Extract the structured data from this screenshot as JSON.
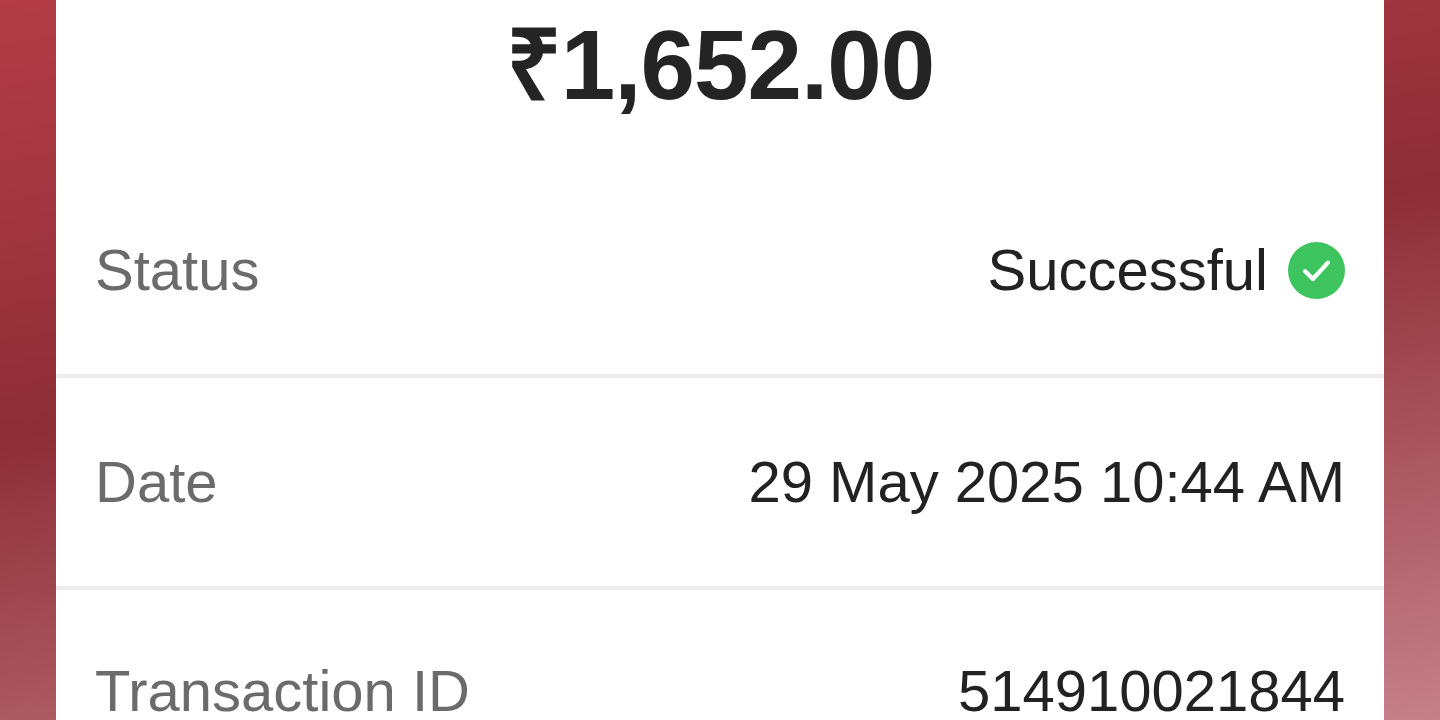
{
  "amount": "₹1,652.00",
  "details": [
    {
      "kind": "status",
      "label": "Status",
      "value": "Successful"
    },
    {
      "kind": "text",
      "label": "Date",
      "value": "29 May 2025 10:44 AM"
    },
    {
      "kind": "text",
      "label": "Transaction ID",
      "value": "514910021844"
    }
  ]
}
